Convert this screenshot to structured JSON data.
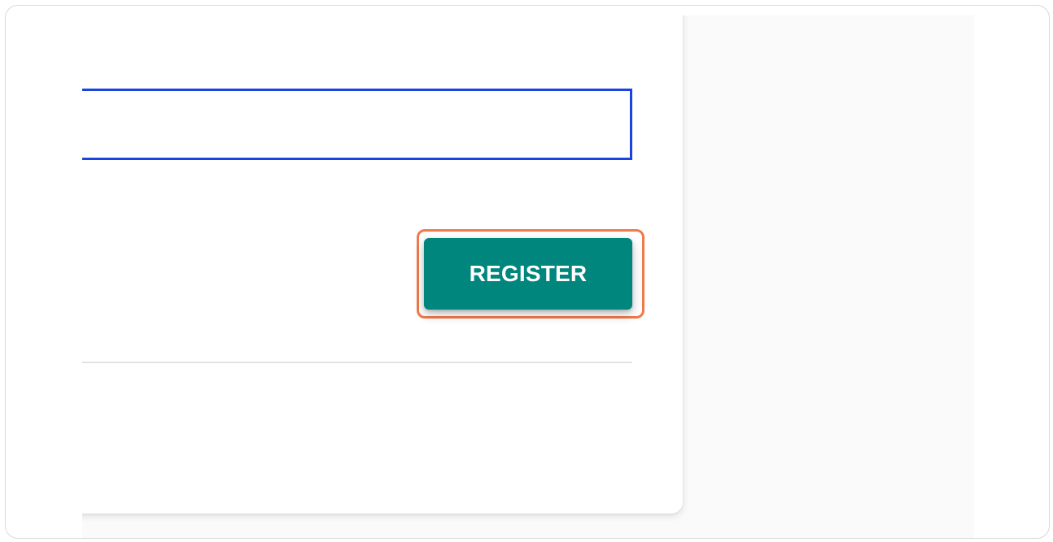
{
  "form": {
    "input_value": "",
    "input_placeholder": "",
    "register_label": "REGISTER"
  },
  "colors": {
    "input_focus_border": "#1a44e0",
    "button_background": "#00867d",
    "highlight_ring": "#f07a4a"
  }
}
